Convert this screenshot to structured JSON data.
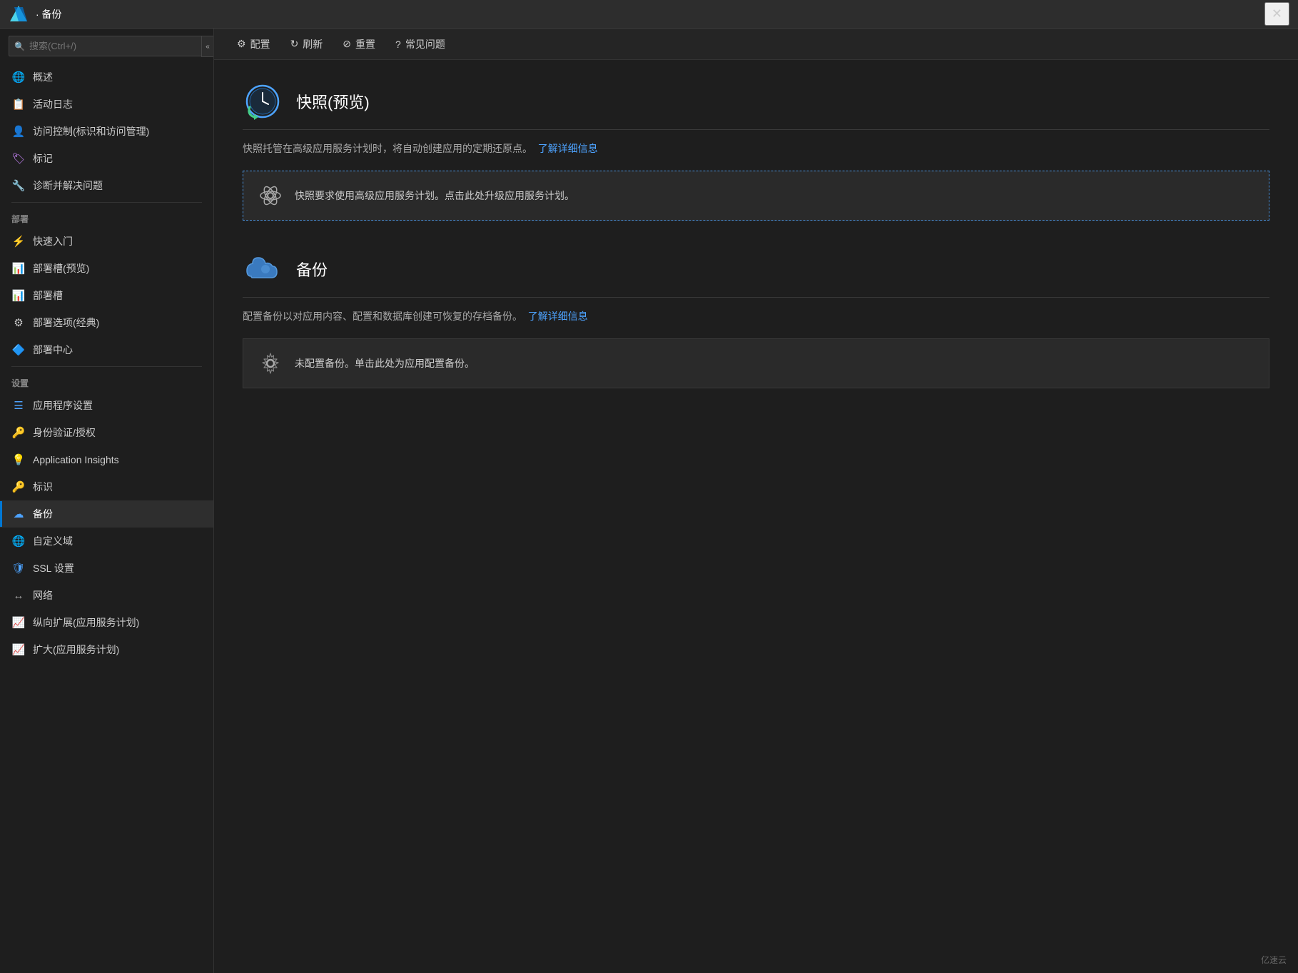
{
  "titleBar": {
    "title": "· 备份",
    "closeLabel": "✕"
  },
  "sidebar": {
    "searchPlaceholder": "搜索(Ctrl+/)",
    "collapseLabel": "«",
    "items": [
      {
        "id": "overview",
        "label": "概述",
        "icon": "🌐",
        "iconColor": "#4da3ff"
      },
      {
        "id": "activity-log",
        "label": "活动日志",
        "icon": "📋",
        "iconColor": "#4da3ff"
      },
      {
        "id": "access-control",
        "label": "访问控制(标识和访问管理)",
        "icon": "👤",
        "iconColor": "#4da3ff"
      },
      {
        "id": "tags",
        "label": "标记",
        "icon": "🏷",
        "iconColor": "#cc88ff"
      },
      {
        "id": "diagnose",
        "label": "诊断并解决问题",
        "icon": "🔧",
        "iconColor": "#cccccc"
      }
    ],
    "deploySection": "部署",
    "deployItems": [
      {
        "id": "quickstart",
        "label": "快速入门",
        "icon": "⚡",
        "iconColor": "#4da3ff"
      },
      {
        "id": "deploy-slots-preview",
        "label": "部署槽(预览)",
        "icon": "📊",
        "iconColor": "#4da3ff"
      },
      {
        "id": "deploy-slots",
        "label": "部署槽",
        "icon": "📊",
        "iconColor": "#4da3ff"
      },
      {
        "id": "deploy-options",
        "label": "部署选项(经典)",
        "icon": "⚙",
        "iconColor": "#cccccc"
      },
      {
        "id": "deploy-center",
        "label": "部署中心",
        "icon": "🔷",
        "iconColor": "#4da3ff"
      }
    ],
    "settingsSection": "设置",
    "settingsItems": [
      {
        "id": "app-settings",
        "label": "应用程序设置",
        "icon": "☰",
        "iconColor": "#4da3ff"
      },
      {
        "id": "auth",
        "label": "身份验证/授权",
        "icon": "🔑",
        "iconColor": "#ffcc00"
      },
      {
        "id": "app-insights",
        "label": "Application Insights",
        "icon": "💡",
        "iconColor": "#cc88ff"
      },
      {
        "id": "identity",
        "label": "标识",
        "icon": "🔑",
        "iconColor": "#ffaa00"
      },
      {
        "id": "backup",
        "label": "备份",
        "icon": "☁",
        "iconColor": "#4da3ff",
        "active": true
      },
      {
        "id": "custom-domain",
        "label": "自定义域",
        "icon": "🌐",
        "iconColor": "#4da3ff"
      },
      {
        "id": "ssl",
        "label": "SSL 设置",
        "icon": "🛡",
        "iconColor": "#4da3ff"
      },
      {
        "id": "network",
        "label": "网络",
        "icon": "↔",
        "iconColor": "#aaaaaa"
      },
      {
        "id": "scale-up",
        "label": "纵向扩展(应用服务计划)",
        "icon": "📈",
        "iconColor": "#4da3ff"
      },
      {
        "id": "scale-out",
        "label": "扩大(应用服务计划)",
        "icon": "📈",
        "iconColor": "#4da3ff"
      }
    ]
  },
  "toolbar": {
    "configLabel": "配置",
    "refreshLabel": "刷新",
    "resetLabel": "重置",
    "faqLabel": "常见问题"
  },
  "snapshot": {
    "title": "快照(预览)",
    "description": "快照托管在高级应用服务计划时，将自动创建应用的定期还原点。",
    "learnMoreLabel": "了解详细信息",
    "infoText": "快照要求使用高级应用服务计划。点击此处升级应用服务计划。"
  },
  "backup": {
    "title": "备份",
    "description": "配置备份以对应用内容、配置和数据库创建可恢复的存档备份。",
    "learnMoreLabel": "了解详细信息",
    "infoText": "未配置备份。单击此处为应用配置备份。"
  },
  "watermark": "亿速云"
}
